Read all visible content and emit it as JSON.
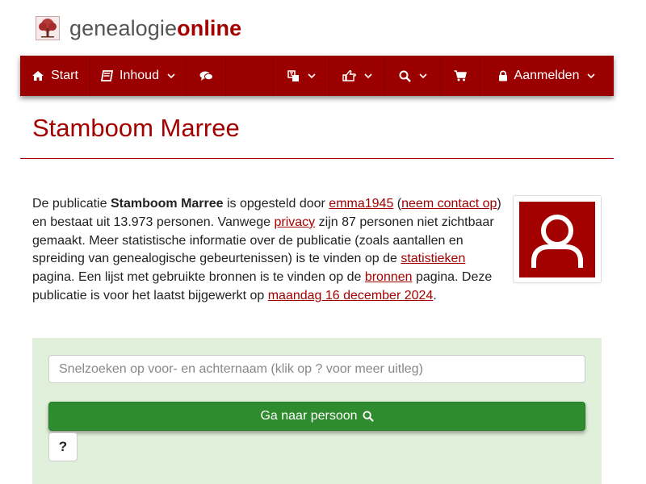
{
  "site": {
    "logo_part1": "genealogie",
    "logo_part2": "online"
  },
  "nav": {
    "start": {
      "label": "Start",
      "icon": "home-icon"
    },
    "inhoud": {
      "label": "Inhoud",
      "icon": "book-icon"
    },
    "chat": {
      "icon": "comments-icon"
    },
    "language": {
      "icon": "translate-icon"
    },
    "share": {
      "icon": "hand-pointer-icon"
    },
    "search": {
      "icon": "search-icon"
    },
    "cart": {
      "icon": "shopping-cart-icon"
    },
    "login": {
      "label": "Aanmelden",
      "icon": "lock-icon"
    }
  },
  "page": {
    "title": "Stamboom Marree"
  },
  "description": {
    "t1": "De publicatie ",
    "pub_name": "Stamboom Marree",
    "t2": " is opgesteld door ",
    "author_link": "emma1945",
    "t3": " (",
    "contact_link": "neem contact op",
    "t4": ") en bestaat uit 13.973 personen. Vanwege ",
    "privacy_link": "privacy",
    "t5": " zijn 87 personen niet zichtbaar gemaakt. Meer statistische informatie over de publicatie (zoals aantallen en spreiding van genealogische gebeurtenissen) is te vinden op de ",
    "stats_link": "statistieken",
    "t6": " pagina. Een lijst met gebruikte bronnen is te vinden op de ",
    "sources_link": "bronnen",
    "t7": " pagina. Deze publicatie is voor het laatst bijgewerkt op ",
    "date_link": "maandag 16 december 2024",
    "t8": "."
  },
  "search": {
    "placeholder": "Snelzoeken op voor- en achternaam (klik op ? voor meer uitleg)",
    "value": "",
    "button_label": "Ga naar persoon",
    "help_label": "?"
  },
  "colors": {
    "brand": "#9b0000",
    "accent": "#a30000",
    "panel_bg": "#e1f0da",
    "button_green": "#2e8b2e"
  }
}
